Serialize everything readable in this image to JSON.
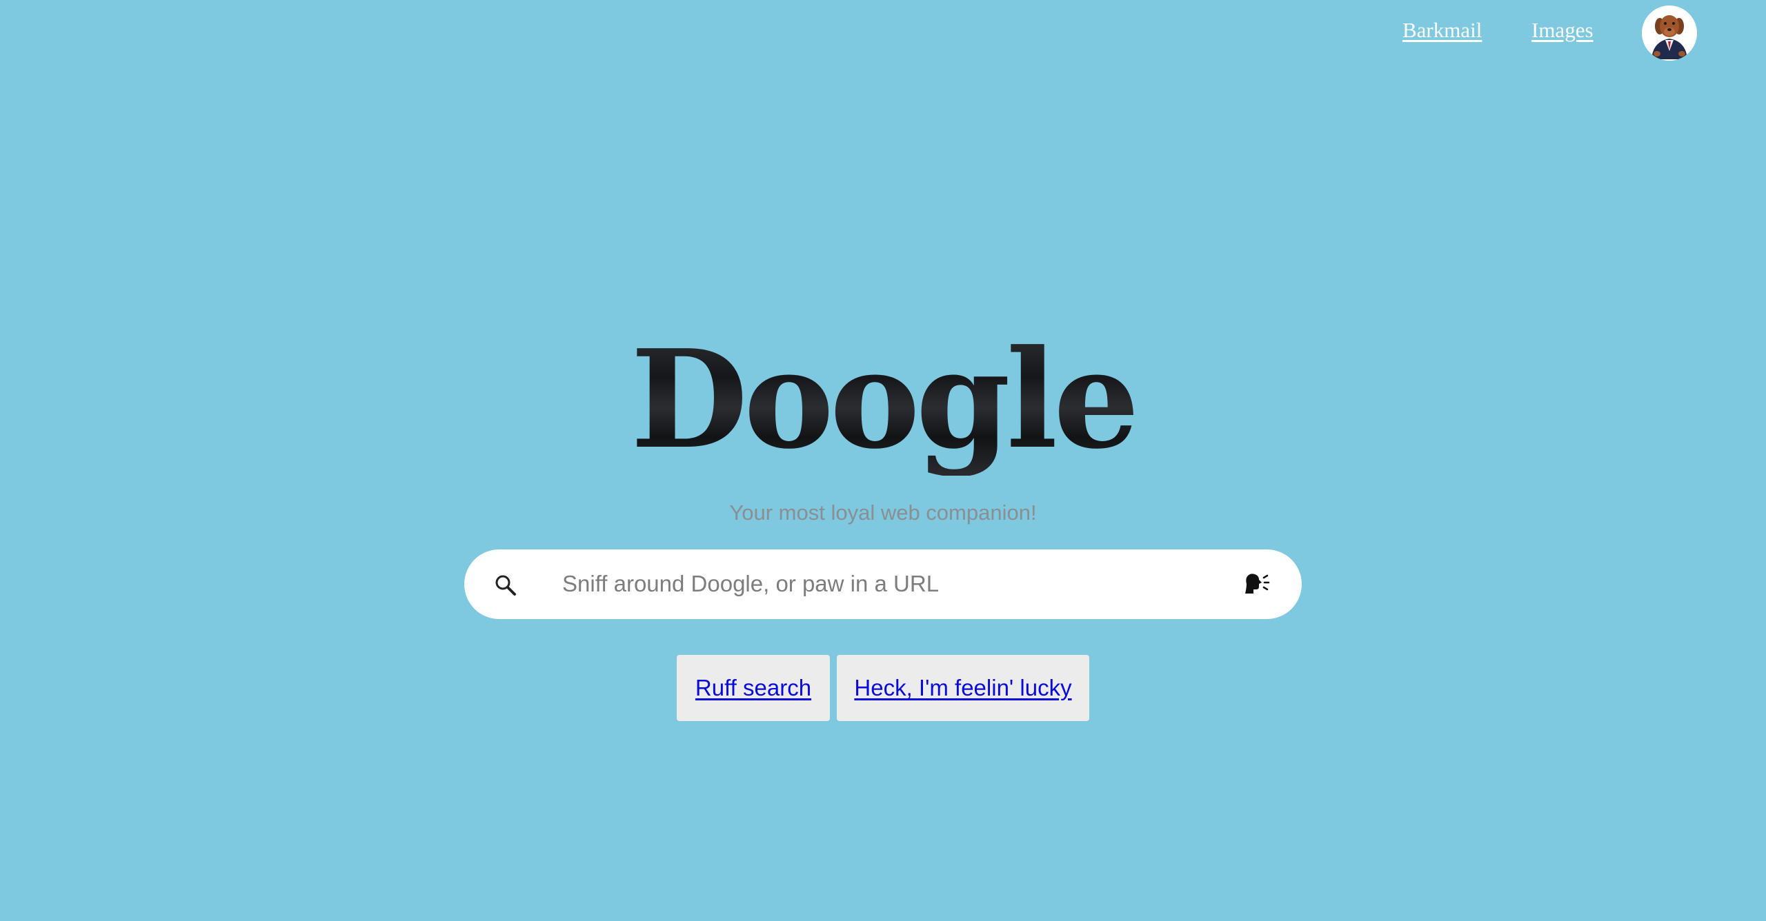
{
  "nav": {
    "barkmail_label": "Barkmail",
    "images_label": "Images",
    "avatar_icon": "dog-in-suit-avatar"
  },
  "logo": {
    "text": "Doogle"
  },
  "tagline": "Your most loyal web companion!",
  "search": {
    "placeholder": "Sniff around Doogle, or paw in a URL",
    "value": "",
    "left_icon": "search-icon",
    "right_icon": "voice-bark-icon"
  },
  "buttons": {
    "search_label": "Ruff search",
    "lucky_label": "Heck, I'm feelin' lucky"
  },
  "colors": {
    "background": "#7ec8e0",
    "link_blue": "#0b0bd9",
    "button_bg": "#ececec",
    "tagline": "#8a8f93"
  }
}
